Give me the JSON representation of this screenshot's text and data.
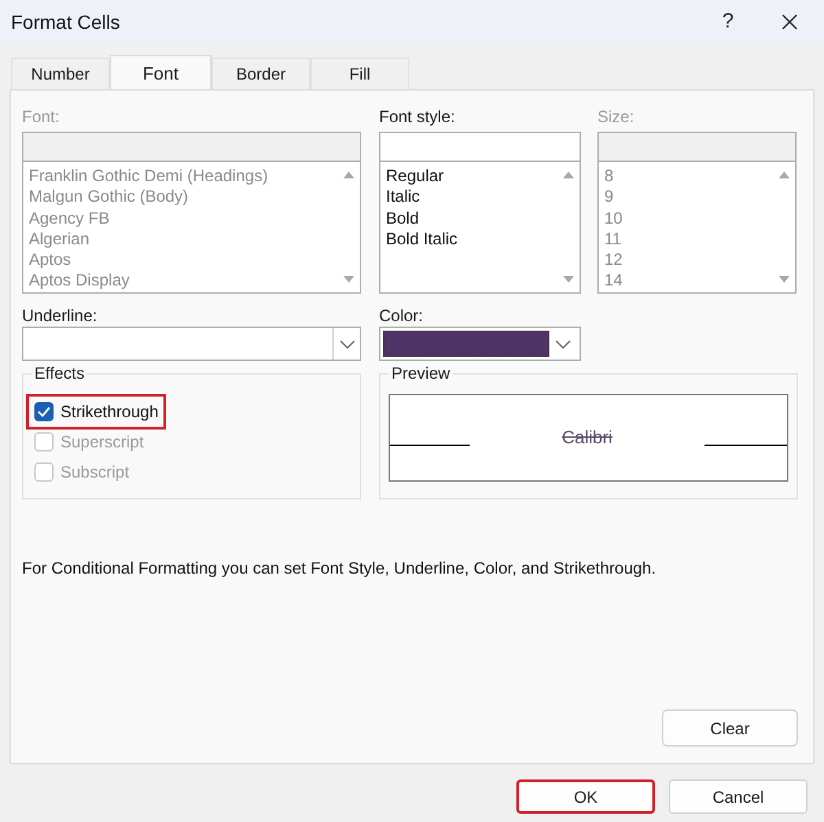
{
  "window": {
    "title": "Format Cells",
    "help": "?"
  },
  "tabs": [
    {
      "label": "Number",
      "selected": false
    },
    {
      "label": "Font",
      "selected": true
    },
    {
      "label": "Border",
      "selected": false
    },
    {
      "label": "Fill",
      "selected": false
    }
  ],
  "font": {
    "label": "Font:",
    "disabled": true,
    "items": [
      "Franklin Gothic Demi (Headings)",
      "Malgun Gothic (Body)",
      "Agency FB",
      "Algerian",
      "Aptos",
      "Aptos Display"
    ]
  },
  "font_style": {
    "label": "Font style:",
    "disabled": false,
    "items": [
      "Regular",
      "Italic",
      "Bold",
      "Bold Italic"
    ]
  },
  "size": {
    "label": "Size:",
    "disabled": true,
    "items": [
      "8",
      "9",
      "10",
      "11",
      "12",
      "14"
    ]
  },
  "underline": {
    "label": "Underline:"
  },
  "color": {
    "label": "Color:",
    "color": "#4f3366"
  },
  "effects": {
    "title": "Effects",
    "options": [
      {
        "label": "Strikethrough",
        "checked": true,
        "disabled": false,
        "highlighted": true
      },
      {
        "label": "Superscript",
        "checked": false,
        "disabled": true,
        "highlighted": false
      },
      {
        "label": "Subscript",
        "checked": false,
        "disabled": true,
        "highlighted": false
      }
    ]
  },
  "preview": {
    "title": "Preview",
    "sample": "Calibri",
    "strikethrough": true
  },
  "note": "For Conditional Formatting you can set Font Style, Underline, Color, and Strikethrough.",
  "clear_button": "Clear",
  "buttons": [
    {
      "label": "OK",
      "highlighted": true
    },
    {
      "label": "Cancel",
      "highlighted": false
    }
  ]
}
